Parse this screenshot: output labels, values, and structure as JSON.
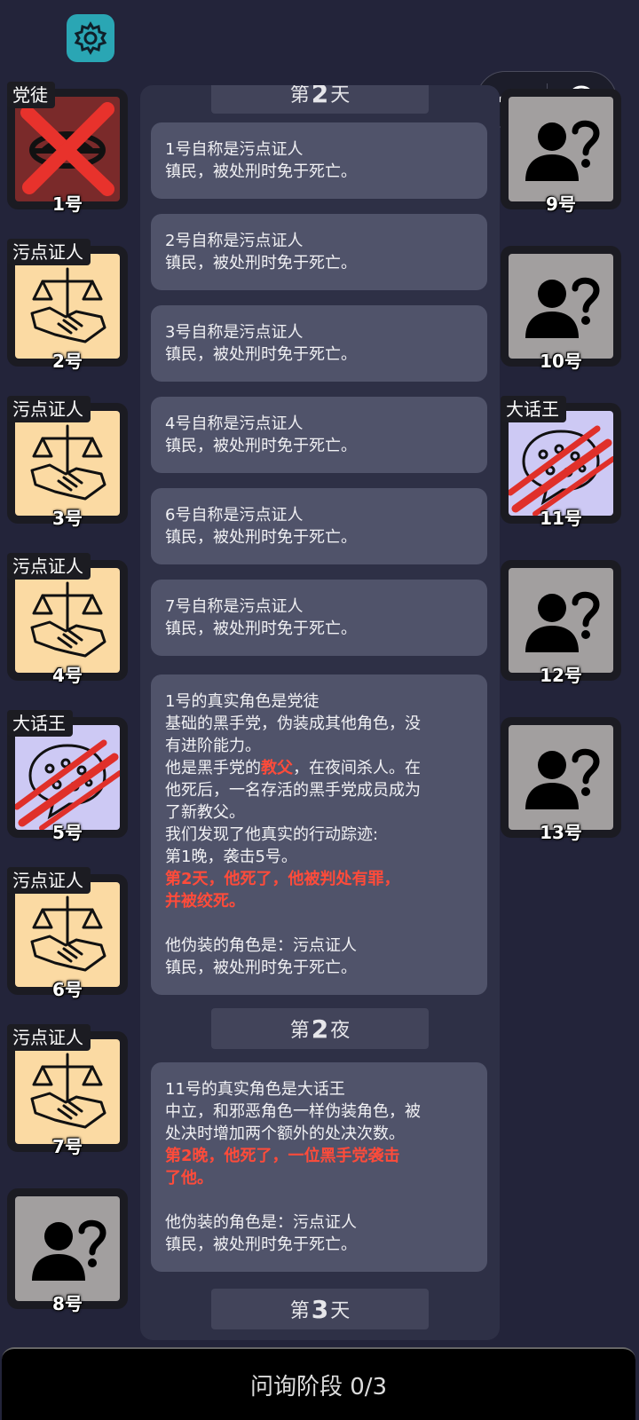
{
  "top": {
    "settings_icon": "gear-icon",
    "capsule": {
      "more_icon": "more-dots-icon",
      "close_icon": "target-circle-icon"
    }
  },
  "left_players": [
    {
      "number": "1号",
      "tag": "党徒",
      "status": "dead-executed",
      "icon": "mafia-icon"
    },
    {
      "number": "2号",
      "tag": "污点证人",
      "status": "alive",
      "icon": "scales-handshake-icon"
    },
    {
      "number": "3号",
      "tag": "污点证人",
      "status": "alive",
      "icon": "scales-handshake-icon"
    },
    {
      "number": "4号",
      "tag": "污点证人",
      "status": "alive",
      "icon": "scales-handshake-icon"
    },
    {
      "number": "5号",
      "tag": "大话王",
      "status": "killed",
      "icon": "speech-bubble-icon"
    },
    {
      "number": "6号",
      "tag": "污点证人",
      "status": "alive",
      "icon": "scales-handshake-icon"
    },
    {
      "number": "7号",
      "tag": "污点证人",
      "status": "alive",
      "icon": "scales-handshake-icon"
    },
    {
      "number": "8号",
      "tag": "",
      "status": "unknown",
      "icon": "unknown-person-icon"
    }
  ],
  "right_players": [
    {
      "number": "9号",
      "tag": "",
      "status": "unknown",
      "icon": "unknown-person-icon"
    },
    {
      "number": "10号",
      "tag": "",
      "status": "unknown",
      "icon": "unknown-person-icon"
    },
    {
      "number": "11号",
      "tag": "大话王",
      "status": "killed",
      "icon": "speech-bubble-icon"
    },
    {
      "number": "12号",
      "tag": "",
      "status": "unknown",
      "icon": "unknown-person-icon"
    },
    {
      "number": "13号",
      "tag": "",
      "status": "unknown",
      "icon": "unknown-person-icon"
    }
  ],
  "log": {
    "day2_header": {
      "pre": "第",
      "num": "2",
      "post": "天"
    },
    "claims": [
      {
        "l1": "1号自称是污点证人",
        "l2": "镇民，被处刑时免于死亡。"
      },
      {
        "l1": "2号自称是污点证人",
        "l2": "镇民，被处刑时免于死亡。"
      },
      {
        "l1": "3号自称是污点证人",
        "l2": "镇民，被处刑时免于死亡。"
      },
      {
        "l1": "4号自称是污点证人",
        "l2": "镇民，被处刑时免于死亡。"
      },
      {
        "l1": "6号自称是污点证人",
        "l2": "镇民，被处刑时免于死亡。"
      },
      {
        "l1": "7号自称是污点证人",
        "l2": "镇民，被处刑时免于死亡。"
      }
    ],
    "reveal1": {
      "l1": "1号的真实角色是党徒",
      "l2": "基础的黑手党，伪装成其他角色，没",
      "l3": "有进阶能力。",
      "l4_pre": "他是黑手党的",
      "l4_hl": "教父",
      "l4_post": "，在夜间杀人。在",
      "l5": "他死后，一名存活的黑手党成员成为",
      "l6": "了新教父。",
      "l7": "我们发现了他真实的行动踪迹:",
      "l8": "第1晚，袭击5号。",
      "l9": "第2天，他死了，他被判处有罪，",
      "l10": "并被绞死。",
      "l11": "他伪装的角色是：污点证人",
      "l12": "镇民，被处刑时免于死亡。"
    },
    "night2_header": {
      "pre": "第",
      "num": "2",
      "post": "夜"
    },
    "reveal2": {
      "l1": "11号的真实角色是大话王",
      "l2": "中立，和邪恶角色一样伪装角色，被",
      "l3": "处决时增加两个额外的处决次数。",
      "l4": "第2晚，他死了，一位黑手党袭击",
      "l5": "了他。",
      "l6": "他伪装的角色是：污点证人",
      "l7": "镇民，被处刑时免于死亡。"
    },
    "day3_header": {
      "pre": "第",
      "num": "3",
      "post": "天"
    }
  },
  "bottom_bar": {
    "label": "问询阶段 0/3"
  },
  "colors": {
    "background": "#23243a",
    "accent_red": "#ff4b3a",
    "gear_bg": "#2aa6b4"
  }
}
